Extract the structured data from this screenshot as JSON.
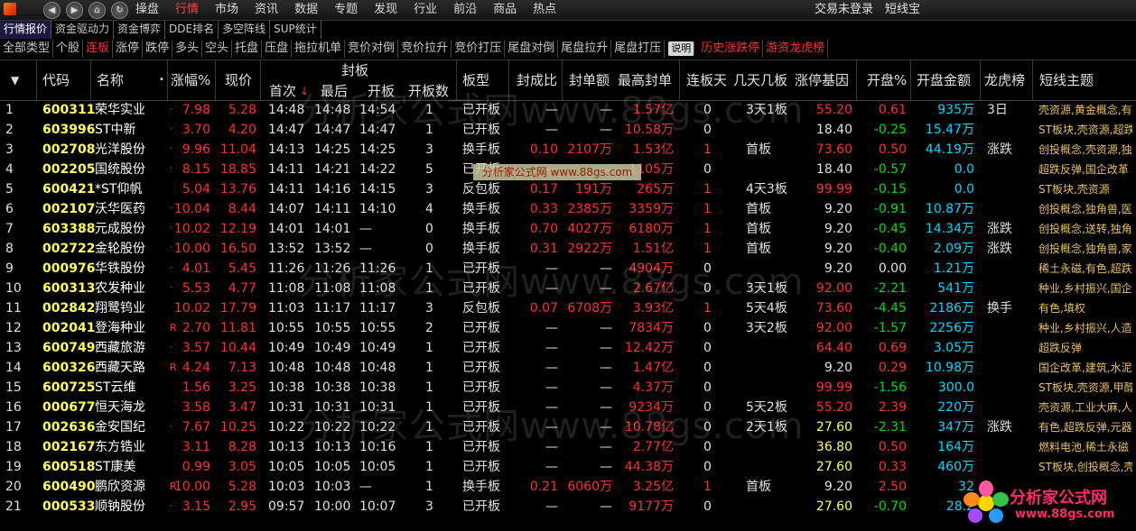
{
  "menubar": {
    "menus": [
      "操盘",
      "行情",
      "市场",
      "资讯",
      "数据",
      "专题",
      "发现",
      "行业",
      "前沿",
      "商品",
      "热点"
    ],
    "active_menu": "行情",
    "trade_status": "交易未登录",
    "shortline_link": "短线宝",
    "logo_icon": "app-logo-icon",
    "window_buttons": [
      "back-icon",
      "forward-icon",
      "home-icon",
      "refresh-icon",
      "stop-icon"
    ]
  },
  "subtabs": {
    "items": [
      "行情报价",
      "资金驱动力",
      "资金博弈",
      "DDE排名",
      "多空阵线",
      "SUP统计"
    ],
    "active": "行情报价"
  },
  "filters": {
    "items": [
      "全部类型",
      "个股",
      "连板",
      "涨停",
      "跌停",
      "多头",
      "空头",
      "托盘",
      "压盘",
      "拖拉机单",
      "竞价对倒",
      "竞价拉升",
      "竞价打压",
      "尾盘对倒",
      "尾盘拉升",
      "尾盘打压",
      "说明",
      "历史涨跌停",
      "游资龙虎榜"
    ],
    "active": "连板",
    "red_items": [
      "历史涨跌停",
      "游资龙虎榜"
    ],
    "explain_item": "说明"
  },
  "table": {
    "headers": {
      "code": "代码",
      "name": "名称",
      "pct": "涨幅%",
      "price": "现价",
      "seal_group": "封板",
      "first": "首次",
      "last": "最后",
      "open": "开板",
      "open_count": "开板数",
      "type": "板型",
      "ratio": "封成比",
      "seal_amount": "封单额",
      "max_seal": "最高封单",
      "streak": "连板天",
      "days": "几天几板",
      "gene": "涨停基因",
      "open_pct": "开盘%",
      "open_amount": "开盘金额",
      "dragon": "龙虎榜",
      "theme": "短线主题"
    },
    "rows": [
      {
        "idx": "1",
        "code": "600311",
        "name": "荣华实业",
        "flag": "·",
        "pct": "7.98",
        "price": "5.28",
        "first": "14:48",
        "last": "14:48",
        "open": "14:54",
        "open_count": "1",
        "type": "已开板",
        "ratio": "—",
        "seal_amount": "—",
        "max_seal": "1.57亿",
        "streak": "0",
        "days": "3天1板",
        "gene": "55.20",
        "open_pct": "0.61",
        "open_amount": "935万",
        "dragon": "3日",
        "theme": "壳资源,黄金概念,有"
      },
      {
        "idx": "2",
        "code": "603996",
        "name": "ST中新",
        "flag": "·",
        "pct": "3.70",
        "price": "4.20",
        "first": "14:47",
        "last": "14:47",
        "open": "14:47",
        "open_count": "1",
        "type": "已开板",
        "ratio": "—",
        "seal_amount": "—",
        "max_seal": "10.58万",
        "streak": "0",
        "days": "",
        "gene": "18.40",
        "open_pct": "-0.25",
        "open_amount": "15.47万",
        "dragon": "",
        "theme": "ST板块,壳资源,超跌"
      },
      {
        "idx": "3",
        "code": "002708",
        "name": "光洋股份",
        "flag": "·",
        "pct": "9.96",
        "price": "11.04",
        "first": "14:13",
        "last": "14:25",
        "open": "14:25",
        "open_count": "3",
        "type": "换手板",
        "ratio": "0.10",
        "seal_amount": "2107万",
        "max_seal": "1.53亿",
        "streak": "1",
        "days": "首板",
        "gene": "73.60",
        "open_pct": "0.50",
        "open_amount": "44.19万",
        "dragon": "涨跌",
        "theme": "创投概念,壳资源,独"
      },
      {
        "idx": "4",
        "code": "002205",
        "name": "国统股份",
        "flag": "·",
        "pct": "8.15",
        "price": "18.85",
        "first": "14:11",
        "last": "14:21",
        "open": "14:22",
        "open_count": "5",
        "type": "已开板",
        "ratio": "—",
        "seal_amount": "—",
        "max_seal": "1105万",
        "streak": "0",
        "days": "",
        "gene": "18.40",
        "open_pct": "-0.57",
        "open_amount": "0.0",
        "dragon": "",
        "theme": "超跌反弹,国企改革"
      },
      {
        "idx": "5",
        "code": "600421",
        "name": "*ST仰帆",
        "flag": "",
        "pct": "5.04",
        "price": "13.76",
        "first": "14:11",
        "last": "14:16",
        "open": "14:15",
        "open_count": "3",
        "type": "反包板",
        "ratio": "0.17",
        "seal_amount": "191万",
        "max_seal": "265万",
        "streak": "1",
        "days": "4天3板",
        "gene": "99.99",
        "open_pct": "-0.15",
        "open_amount": "0.0",
        "dragon": "",
        "theme": "ST板块,壳资源"
      },
      {
        "idx": "6",
        "code": "002107",
        "name": "沃华医药",
        "flag": "·",
        "pct": "10.04",
        "price": "8.44",
        "first": "14:07",
        "last": "14:11",
        "open": "14:10",
        "open_count": "4",
        "type": "换手板",
        "ratio": "0.33",
        "seal_amount": "2385万",
        "max_seal": "3359万",
        "streak": "1",
        "days": "首板",
        "gene": "9.20",
        "open_pct": "-0.91",
        "open_amount": "10.87万",
        "dragon": "",
        "theme": "创投概念,独角兽,医"
      },
      {
        "idx": "7",
        "code": "603388",
        "name": "元成股份",
        "flag": "·",
        "pct": "10.02",
        "price": "12.19",
        "first": "14:01",
        "last": "14:01",
        "open": "—",
        "open_count": "0",
        "type": "换手板",
        "ratio": "0.70",
        "seal_amount": "4027万",
        "max_seal": "6180万",
        "streak": "1",
        "days": "首板",
        "gene": "9.20",
        "open_pct": "-0.45",
        "open_amount": "14.34万",
        "dragon": "涨跌",
        "theme": "创投概念,送转,独角"
      },
      {
        "idx": "8",
        "code": "002722",
        "name": "金轮股份",
        "flag": "·",
        "pct": "10.00",
        "price": "16.50",
        "first": "13:52",
        "last": "13:52",
        "open": "—",
        "open_count": "0",
        "type": "换手板",
        "ratio": "0.31",
        "seal_amount": "2922万",
        "max_seal": "1.51亿",
        "streak": "1",
        "days": "首板",
        "gene": "9.20",
        "open_pct": "-0.40",
        "open_amount": "2.09万",
        "dragon": "涨跌",
        "theme": "创投概念,独角兽,家"
      },
      {
        "idx": "9",
        "code": "000976",
        "name": "华铁股份",
        "flag": "·",
        "pct": "4.01",
        "price": "5.45",
        "first": "11:26",
        "last": "11:26",
        "open": "11:26",
        "open_count": "1",
        "type": "已开板",
        "ratio": "—",
        "seal_amount": "—",
        "max_seal": "4904万",
        "streak": "0",
        "days": "",
        "gene": "9.20",
        "open_pct": "0.00",
        "open_amount": "1.21万",
        "dragon": "",
        "theme": "稀土永磁,有色,超跌"
      },
      {
        "idx": "10",
        "code": "600313",
        "name": "农发种业",
        "flag": "·",
        "pct": "5.53",
        "price": "4.77",
        "first": "11:08",
        "last": "11:08",
        "open": "11:08",
        "open_count": "1",
        "type": "已开板",
        "ratio": "—",
        "seal_amount": "—",
        "max_seal": "2.67亿",
        "streak": "0",
        "days": "3天1板",
        "gene": "92.00",
        "open_pct": "-2.21",
        "open_amount": "541万",
        "dragon": "",
        "theme": "种业,乡村振兴,国企"
      },
      {
        "idx": "11",
        "code": "002842",
        "name": "翔鹭钨业",
        "flag": "",
        "pct": "10.02",
        "price": "17.79",
        "first": "11:03",
        "last": "11:17",
        "open": "11:17",
        "open_count": "3",
        "type": "反包板",
        "ratio": "0.07",
        "seal_amount": "6708万",
        "max_seal": "3.93亿",
        "streak": "1",
        "days": "5天4板",
        "gene": "73.60",
        "open_pct": "-4.45",
        "open_amount": "2186万",
        "dragon": "换手",
        "theme": "有色,填权"
      },
      {
        "idx": "12",
        "code": "002041",
        "name": "登海种业",
        "flag": "R",
        "pct": "2.70",
        "price": "11.81",
        "first": "10:55",
        "last": "10:55",
        "open": "10:55",
        "open_count": "2",
        "type": "已开板",
        "ratio": "—",
        "seal_amount": "—",
        "max_seal": "7834万",
        "streak": "0",
        "days": "3天2板",
        "gene": "92.00",
        "open_pct": "-1.57",
        "open_amount": "2256万",
        "dragon": "",
        "theme": "种业,乡村振兴,人造"
      },
      {
        "idx": "13",
        "code": "600749",
        "name": "西藏旅游",
        "flag": "·",
        "pct": "3.57",
        "price": "10.44",
        "first": "10:49",
        "last": "10:49",
        "open": "10:49",
        "open_count": "1",
        "type": "已开板",
        "ratio": "—",
        "seal_amount": "—",
        "max_seal": "12.42万",
        "streak": "0",
        "days": "",
        "gene": "64.40",
        "open_pct": "0.69",
        "open_amount": "3.05万",
        "dragon": "",
        "theme": "超跌反弹"
      },
      {
        "idx": "14",
        "code": "600326",
        "name": "西藏天路",
        "flag": "R",
        "pct": "4.24",
        "price": "7.13",
        "first": "10:48",
        "last": "10:48",
        "open": "10:48",
        "open_count": "1",
        "type": "已开板",
        "ratio": "—",
        "seal_amount": "—",
        "max_seal": "1.47亿",
        "streak": "0",
        "days": "",
        "gene": "9.20",
        "open_pct": "0.29",
        "open_amount": "10.98万",
        "dragon": "",
        "theme": "国企改革,建筑,水泥"
      },
      {
        "idx": "15",
        "code": "600725",
        "name": "ST云维",
        "flag": "",
        "pct": "1.56",
        "price": "3.25",
        "first": "10:38",
        "last": "10:38",
        "open": "10:38",
        "open_count": "1",
        "type": "已开板",
        "ratio": "—",
        "seal_amount": "—",
        "max_seal": "4.37万",
        "streak": "0",
        "days": "",
        "gene": "99.99",
        "open_pct": "-1.56",
        "open_amount": "300.0",
        "dragon": "",
        "theme": "ST板块,壳资源,甲醇"
      },
      {
        "idx": "16",
        "code": "000677",
        "name": "恒天海龙",
        "flag": "",
        "pct": "3.58",
        "price": "3.47",
        "first": "10:31",
        "last": "10:31",
        "open": "10:31",
        "open_count": "1",
        "type": "已开板",
        "ratio": "—",
        "seal_amount": "—",
        "max_seal": "9234万",
        "streak": "0",
        "days": "5天2板",
        "gene": "55.20",
        "open_pct": "2.39",
        "open_amount": "220万",
        "dragon": "",
        "theme": "壳资源,工业大麻,人"
      },
      {
        "idx": "17",
        "code": "002636",
        "name": "金安国纪",
        "flag": "·",
        "pct": "7.67",
        "price": "10.25",
        "first": "10:22",
        "last": "10:22",
        "open": "10:22",
        "open_count": "1",
        "type": "已开板",
        "ratio": "—",
        "seal_amount": "—",
        "max_seal": "10.78亿",
        "streak": "0",
        "days": "2天1板",
        "gene": "27.60",
        "open_pct": "-2.31",
        "open_amount": "347万",
        "dragon": "涨跌",
        "theme": "有色,超跌反弹,元器"
      },
      {
        "idx": "18",
        "code": "002167",
        "name": "东方锆业",
        "flag": "",
        "pct": "3.11",
        "price": "8.28",
        "first": "10:13",
        "last": "10:13",
        "open": "10:16",
        "open_count": "1",
        "type": "已开板",
        "ratio": "—",
        "seal_amount": "—",
        "max_seal": "2.77亿",
        "streak": "0",
        "days": "",
        "gene": "36.80",
        "open_pct": "0.50",
        "open_amount": "164万",
        "dragon": "",
        "theme": "燃料电池,稀土永磁"
      },
      {
        "idx": "19",
        "code": "600518",
        "name": "ST康美",
        "flag": "",
        "pct": "0.99",
        "price": "3.05",
        "first": "10:05",
        "last": "10:05",
        "open": "10:05",
        "open_count": "1",
        "type": "已开板",
        "ratio": "—",
        "seal_amount": "—",
        "max_seal": "44.38万",
        "streak": "0",
        "days": "",
        "gene": "27.60",
        "open_pct": "0.33",
        "open_amount": "460万",
        "dragon": "",
        "theme": "ST板块,创投概念,壳"
      },
      {
        "idx": "20",
        "code": "600490",
        "name": "鹏欣资源",
        "flag": "R",
        "pct": "10.00",
        "price": "5.28",
        "first": "10:03",
        "last": "10:03",
        "open": "—",
        "open_count": "1",
        "type": "换手板",
        "ratio": "0.21",
        "seal_amount": "6060万",
        "max_seal": "3.25亿",
        "streak": "1",
        "days": "首板",
        "gene": "9.20",
        "open_pct": "2.50",
        "open_amount": "32",
        "dragon": "",
        "theme": ""
      },
      {
        "idx": "21",
        "code": "000533",
        "name": "顺钠股份",
        "flag": "·",
        "pct": "3.15",
        "price": "2.95",
        "first": "09:57",
        "last": "10:00",
        "open": "10:07",
        "open_count": "3",
        "type": "已开板",
        "ratio": "—",
        "seal_amount": "—",
        "max_seal": "9177万",
        "streak": "0",
        "days": "",
        "gene": "27.60",
        "open_pct": "-0.70",
        "open_amount": "28.2",
        "dragon": "",
        "theme": ""
      }
    ]
  },
  "overlay": {
    "watermark_text": "分析家公式网www.88gs.com",
    "banner_text": "分析家公式网 www.88gs.com",
    "brand_name": "分析家公式网",
    "brand_url": "www.88gs.com"
  },
  "colors": {
    "up": "#ff3030",
    "down": "#00e000",
    "code": "#ffff55",
    "amount": "#00d8ff",
    "theme": "#e8c060"
  }
}
